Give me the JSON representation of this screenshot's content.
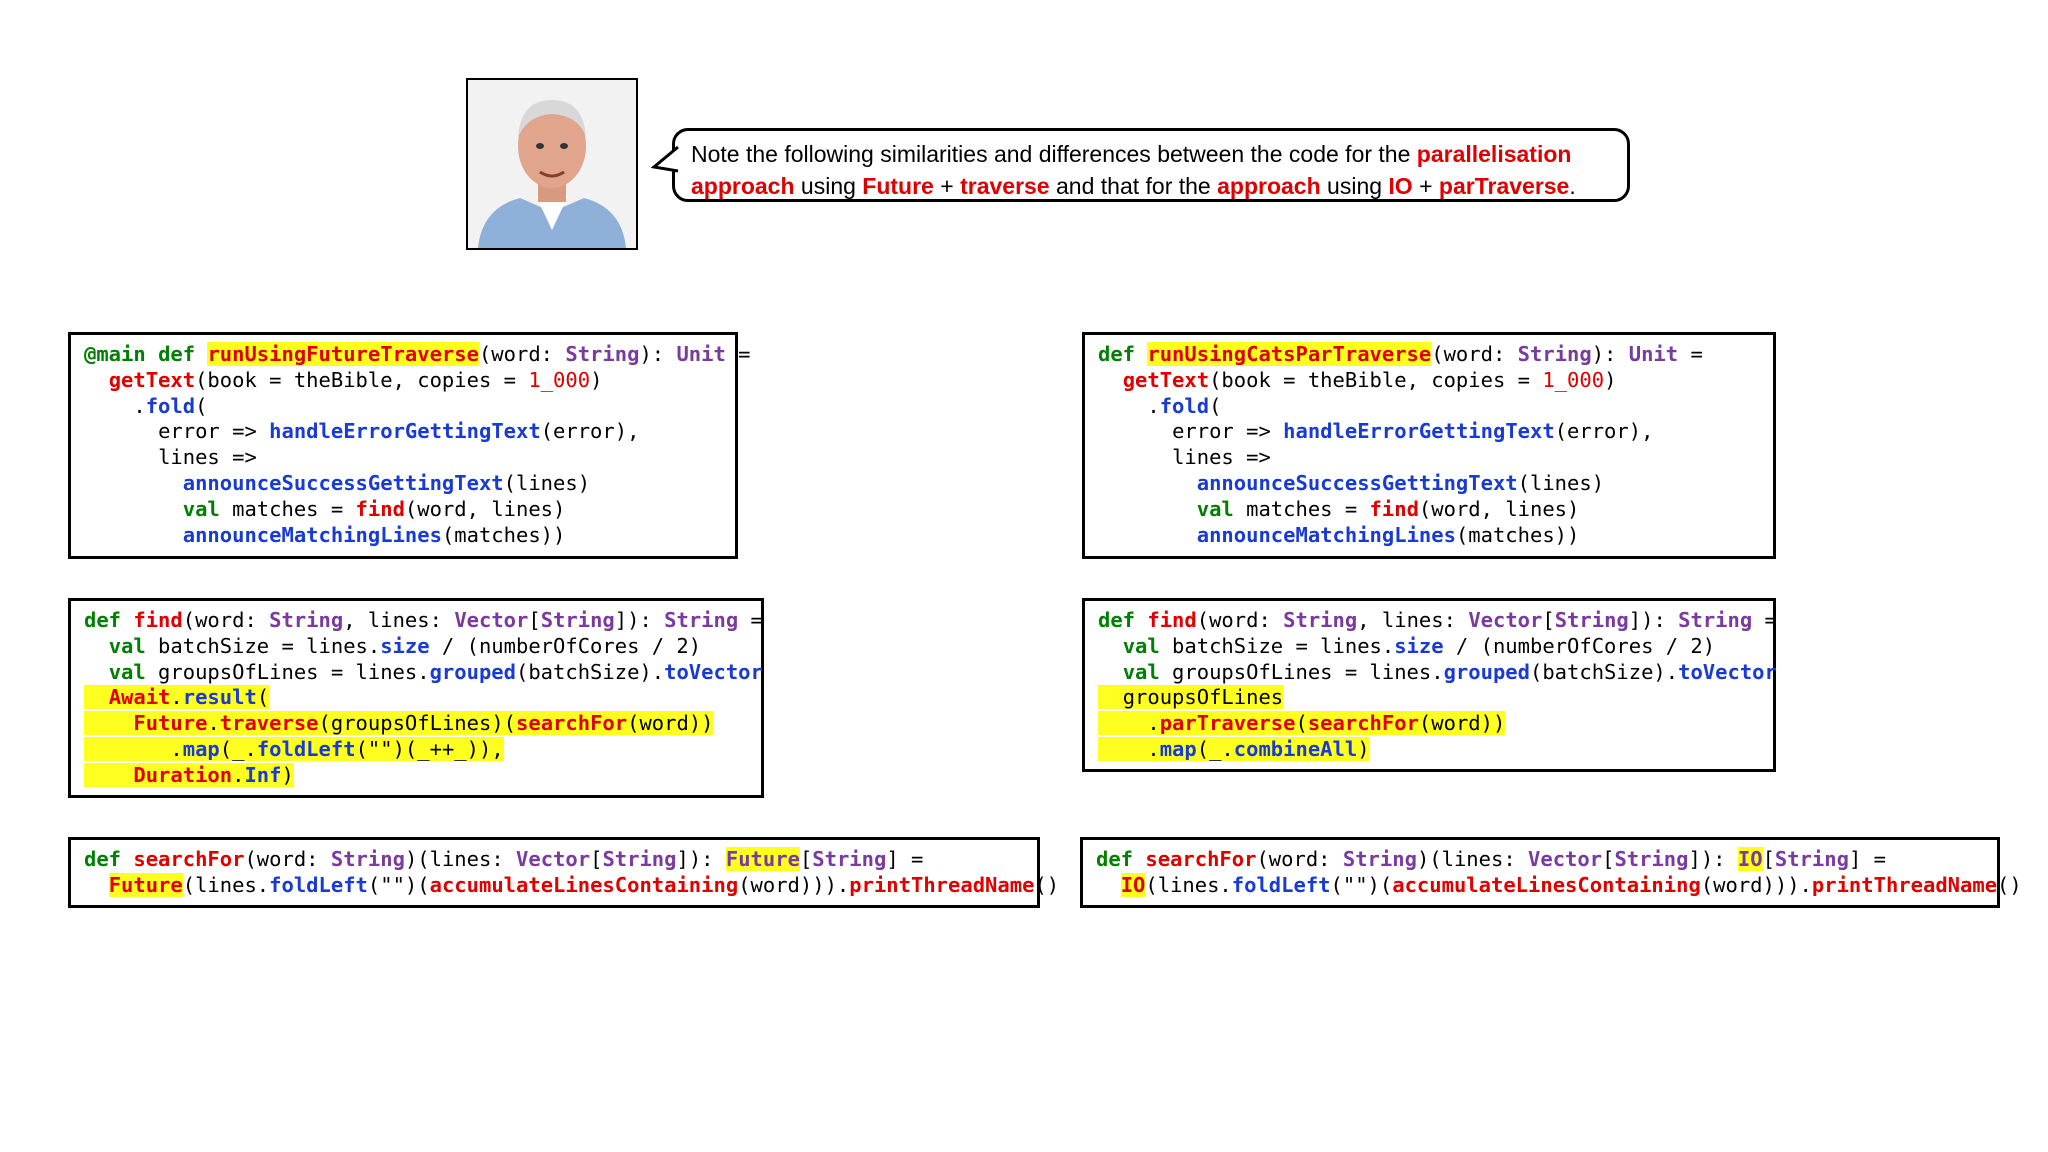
{
  "colors": {
    "keyword": "#008000",
    "type": "#7a3b9e",
    "function": "#e00000",
    "method": "#1a3ad6",
    "highlight": "#ffff20"
  },
  "note": {
    "t1": "Note the following similarities and differences between the code for the ",
    "h1": "parallelisation approach",
    "t2": " using ",
    "h2": "Future",
    "t3": " + ",
    "h3": "traverse",
    "t4": " and that for the ",
    "h4": "approach",
    "t5": " using ",
    "h5": "IO",
    "t6": " + ",
    "h6": "parTraverse",
    "t7": "."
  },
  "code": {
    "main_annotation": "@main",
    "def": "def",
    "val": "val",
    "run_future": "runUsingFutureTraverse",
    "run_cats": "runUsingCatsParTraverse",
    "word_param": "(word: ",
    "string": "String",
    "unit_sig": "): ",
    "unit": "Unit",
    "eq": " =",
    "get_text": "getText",
    "get_text_args1": "(book = theBible, copies = ",
    "copies": "1_000",
    "close_paren": ")",
    "dot": ".",
    "fold": "fold",
    "open_paren": "(",
    "error_arrow": "error => ",
    "handle_error": "handleErrorGettingText",
    "error_close": "(error),",
    "lines_arrow": "lines =>",
    "announce_success": "announceSuccessGettingText",
    "lines_close": "(lines)",
    "matches_eq": " matches = ",
    "find": "find",
    "find_args": "(word, lines)",
    "announce_matching": "announceMatchingLines",
    "matches_close": "(matches))",
    "find_sig1": "(word: ",
    "find_sig2": ", lines: ",
    "vector": "Vector",
    "lbrack": "[",
    "rbrack": "]",
    "find_sig3": "]): ",
    "batch_size": " batchSize = lines.",
    "size": "size",
    "batch_rest": " / (numberOfCores / 2)",
    "groups_of_lines_eq": " groupsOfLines = lines.",
    "grouped": "grouped",
    "batch_arg": "(batchSize).",
    "to_vector": "toVector",
    "await": "Await",
    "result": "result",
    "future": "Future",
    "traverse": "traverse",
    "groups_arg": "(groupsOfLines)(",
    "search_for": "searchFor",
    "word_arg": "(word))",
    "map": "map",
    "fold_left": "foldLeft",
    "fold_left_arg": "(\"\")(_++_)),",
    "duration": "Duration",
    "inf": "Inf",
    "groups_of_lines": "groupsOfLines",
    "par_traverse": "parTraverse",
    "combine_all": "combineAll",
    "combine_arg": "(_.",
    "search_sig1": "(word: ",
    "search_sig2": ")(lines: ",
    "search_sig3": "]): ",
    "future_open": "(lines.",
    "fold_left_empty": "(\"\")(",
    "accumulate": "accumulateLinesContaining",
    "acc_tail": "(word))).",
    "print_thread": "printThreadName",
    "parens": "()",
    "io": "IO",
    "io_open": "(lines."
  }
}
